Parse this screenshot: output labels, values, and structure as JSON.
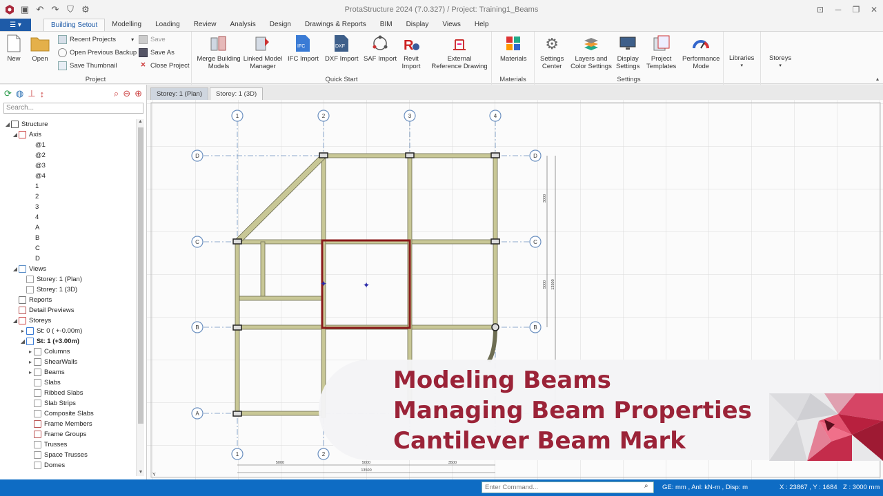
{
  "app": {
    "title": "ProtaStructure 2024 (7.0.327) / Project: Training1_Beams"
  },
  "tabs": {
    "file_label": "☰ ▾",
    "items": [
      "Building Setout",
      "Modelling",
      "Loading",
      "Review",
      "Analysis",
      "Design",
      "Drawings & Reports",
      "BIM",
      "Display",
      "Views",
      "Help"
    ],
    "active": "Building Setout"
  },
  "ribbon": {
    "project": {
      "label": "Project",
      "new": "New",
      "open": "Open",
      "recent": "Recent Projects",
      "open_backup": "Open Previous Backup",
      "save_thumb": "Save Thumbnail",
      "save": "Save",
      "save_as": "Save As",
      "close": "Close Project"
    },
    "quickstart": {
      "label": "Quick Start",
      "merge": "Merge Building\nModels",
      "linked": "Linked Model\nManager",
      "ifc": "IFC Import",
      "dxf": "DXF Import",
      "saf": "SAF Import",
      "revit": "Revit\nImport",
      "extref": "External\nReference Drawing"
    },
    "materials": {
      "label": "Materials",
      "btn": "Materials"
    },
    "settings": {
      "label": "Settings",
      "center": "Settings\nCenter",
      "layers": "Layers and\nColor Settings",
      "display": "Display\nSettings",
      "templates": "Project\nTemplates",
      "perf": "Performance\nMode"
    },
    "libraries": "Libraries",
    "storeys": "Storeys"
  },
  "left_panel": {
    "search_placeholder": "Search...",
    "tree": [
      {
        "label": "Structure",
        "depth": 0,
        "tw": "◢",
        "color": "#555"
      },
      {
        "label": "Axis",
        "depth": 1,
        "tw": "◢",
        "color": "#c44"
      },
      {
        "label": "@1",
        "depth": 3,
        "tw": "",
        "color": ""
      },
      {
        "label": "@2",
        "depth": 3,
        "tw": "",
        "color": ""
      },
      {
        "label": "@3",
        "depth": 3,
        "tw": "",
        "color": ""
      },
      {
        "label": "@4",
        "depth": 3,
        "tw": "",
        "color": ""
      },
      {
        "label": "1",
        "depth": 3,
        "tw": "",
        "color": ""
      },
      {
        "label": "2",
        "depth": 3,
        "tw": "",
        "color": ""
      },
      {
        "label": "3",
        "depth": 3,
        "tw": "",
        "color": ""
      },
      {
        "label": "4",
        "depth": 3,
        "tw": "",
        "color": ""
      },
      {
        "label": "A",
        "depth": 3,
        "tw": "",
        "color": ""
      },
      {
        "label": "B",
        "depth": 3,
        "tw": "",
        "color": ""
      },
      {
        "label": "C",
        "depth": 3,
        "tw": "",
        "color": ""
      },
      {
        "label": "D",
        "depth": 3,
        "tw": "",
        "color": ""
      },
      {
        "label": "Views",
        "depth": 1,
        "tw": "◢",
        "color": "#5b8fc7"
      },
      {
        "label": "Storey: 1 (Plan)",
        "depth": 2,
        "tw": "",
        "color": "#9a9a9a"
      },
      {
        "label": "Storey: 1 (3D)",
        "depth": 2,
        "tw": "",
        "color": "#9a9a9a"
      },
      {
        "label": "Reports",
        "depth": 1,
        "tw": "",
        "color": "#777"
      },
      {
        "label": "Detail Previews",
        "depth": 1,
        "tw": "",
        "color": "#b55"
      },
      {
        "label": "Storeys",
        "depth": 1,
        "tw": "◢",
        "color": "#c44"
      },
      {
        "label": "St: 0 ( +-0.00m)",
        "depth": 2,
        "tw": "▸",
        "color": "#3a7bd5",
        "bold": false
      },
      {
        "label": "St: 1 (+3.00m)",
        "depth": 2,
        "tw": "◢",
        "color": "#3a7bd5",
        "bold": true
      },
      {
        "label": "Columns",
        "depth": 3,
        "tw": "▸",
        "color": "#888"
      },
      {
        "label": "ShearWalls",
        "depth": 3,
        "tw": "▸",
        "color": "#888"
      },
      {
        "label": "Beams",
        "depth": 3,
        "tw": "▸",
        "color": "#888"
      },
      {
        "label": "Slabs",
        "depth": 3,
        "tw": "",
        "color": "#999"
      },
      {
        "label": "Ribbed Slabs",
        "depth": 3,
        "tw": "",
        "color": "#999"
      },
      {
        "label": "Slab Strips",
        "depth": 3,
        "tw": "",
        "color": "#999"
      },
      {
        "label": "Composite Slabs",
        "depth": 3,
        "tw": "",
        "color": "#999"
      },
      {
        "label": "Frame Members",
        "depth": 3,
        "tw": "",
        "color": "#b55"
      },
      {
        "label": "Frame Groups",
        "depth": 3,
        "tw": "",
        "color": "#b55"
      },
      {
        "label": "Trusses",
        "depth": 3,
        "tw": "",
        "color": "#999"
      },
      {
        "label": "Space Trusses",
        "depth": 3,
        "tw": "",
        "color": "#999"
      },
      {
        "label": "Domes",
        "depth": 3,
        "tw": "",
        "color": "#999"
      }
    ]
  },
  "doc_tabs": [
    "Storey: 1 (Plan)",
    "Storey: 1 (3D)"
  ],
  "drawing": {
    "axis_cols": [
      "1",
      "2",
      "3",
      "4"
    ],
    "axis_rows": [
      "D",
      "C",
      "B",
      "A"
    ],
    "dims_bottom": [
      "5000",
      "5000",
      "3500"
    ],
    "dim_total": "13500",
    "dims_right": [
      "3000",
      "5000",
      "13500"
    ],
    "y_label": "Y"
  },
  "statusbar": {
    "command_placeholder": "Enter Command...",
    "units": "GE: mm , Anl: kN-m , Disp: m",
    "coords": "X : 23867 , Y : 1684",
    "zoom": "Z : 3000 mm"
  },
  "overlay": {
    "line1": "Modeling Beams",
    "line2": "Managing Beam Properties",
    "line3": "Cantilever Beam Mark"
  },
  "colors": {
    "accent": "#1e5ba8",
    "status": "#0e6cc4",
    "overlay_text": "#9b2338",
    "beam": "#c8c796",
    "beam_selected": "#8a1a1a"
  }
}
